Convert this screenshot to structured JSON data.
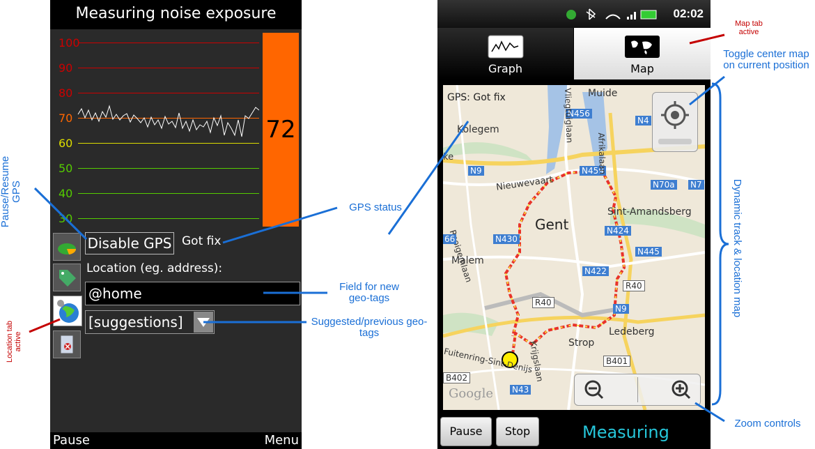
{
  "left_app": {
    "title": "Measuring noise exposure",
    "graph_labels": [
      "100",
      "90",
      "80",
      "70",
      "60",
      "50",
      "40",
      "30"
    ],
    "label_colors": [
      "#cc0000",
      "#cc0000",
      "#cc0000",
      "#ff6600",
      "#dddd00",
      "#55cc00",
      "#55cc00",
      "#55cc00"
    ],
    "current_level": "72",
    "disable_gps_label": "Disable GPS",
    "gps_status": "Got fix",
    "location_label": "Location (eg. address):",
    "location_value": "@home",
    "suggestions_label": "[suggestions]",
    "softkey_left": "Pause",
    "softkey_right": "Menu"
  },
  "right_app": {
    "clock": "02:02",
    "tab_graph": "Graph",
    "tab_map": "Map",
    "gps_overlay": "GPS: Got fix",
    "map_labels": {
      "muide": "Muide",
      "n456": "N456",
      "n4x": "N4",
      "kolegem": "Kolegem",
      "ke": "ke",
      "n9a": "N9",
      "nieuwevaart": "Nieuwevaart",
      "n459": "N459",
      "n70a": "N70a",
      "n7": "N7",
      "sint_amandsberg": "Sint-Amandsberg",
      "rooigemlaan": "Rooigemlaan",
      "gent": "Gent",
      "n424": "N424",
      "n430": "N430",
      "n445": "N445",
      "n66": "66",
      "malem": "Malem",
      "n422": "N422",
      "r40a": "R40",
      "r40b": "R40",
      "n9b": "N9",
      "ledeberg": "Ledeberg",
      "strop": "Strop",
      "kortrijksesteenweg": "Krijgslaan",
      "b401": "B401",
      "b402": "B402",
      "n43": "N43",
      "fuitenring": "Fuitenring-Sint-Denijs",
      "google": "Google",
      "afrikalaan": "Afrikalaan",
      "vliegtuiglaan": "Vliegtuiglaan"
    },
    "pause_label": "Pause",
    "stop_label": "Stop",
    "measuring_label": "Measuring"
  },
  "annotations": {
    "pause_resume_gps": "Pause/Resume GPS",
    "location_tab_active": "Location tab active",
    "gps_status": "GPS status",
    "field_new_geotags": "Field for new geo-tags",
    "suggested_geotags": "Suggested/previous geo-tags",
    "map_tab_active": "Map tab active",
    "toggle_center": "Toggle center map on current position",
    "dynamic_track": "Dynamic track & location map",
    "zoom_controls": "Zoom controls"
  },
  "colors": {
    "meter": "#ff6600",
    "annotation_blue": "#1a6fd6",
    "annotation_red": "#c40000",
    "measuring_text": "#26c6da"
  }
}
